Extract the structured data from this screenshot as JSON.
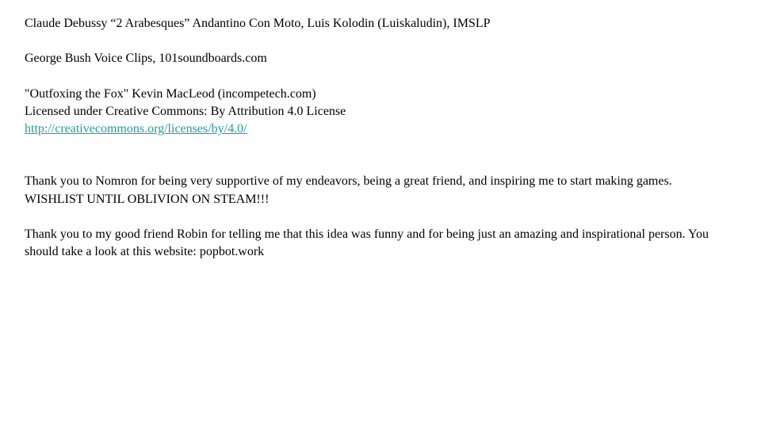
{
  "credits": {
    "music_1": "Claude Debussy “2 Arabesques” Andantino Con Moto, Luis Kolodin (Luiskaludin), IMSLP",
    "sfx_1": "George Bush Voice Clips, 101soundboards.com",
    "music_2_title": "\"Outfoxing the Fox\" Kevin MacLeod (incompetech.com)",
    "music_2_license": "Licensed under Creative Commons: By Attribution 4.0 License",
    "music_2_link": "http://creativecommons.org/licenses/by/4.0/"
  },
  "thanks": {
    "nomron_line_1": "Thank you to Nomron for being very supportive of my endeavors, being a great friend, and inspiring me to start making games.",
    "nomron_line_2": "WISHLIST UNTIL OBLIVION ON STEAM!!!",
    "robin": "Thank you to my good friend Robin for telling me that this idea was funny and for being just an amazing and inspirational person. You should take a look at this website: popbot.work"
  },
  "colors": {
    "text": "#000000",
    "link": "#1a9ea8",
    "background": "#ffffff"
  }
}
